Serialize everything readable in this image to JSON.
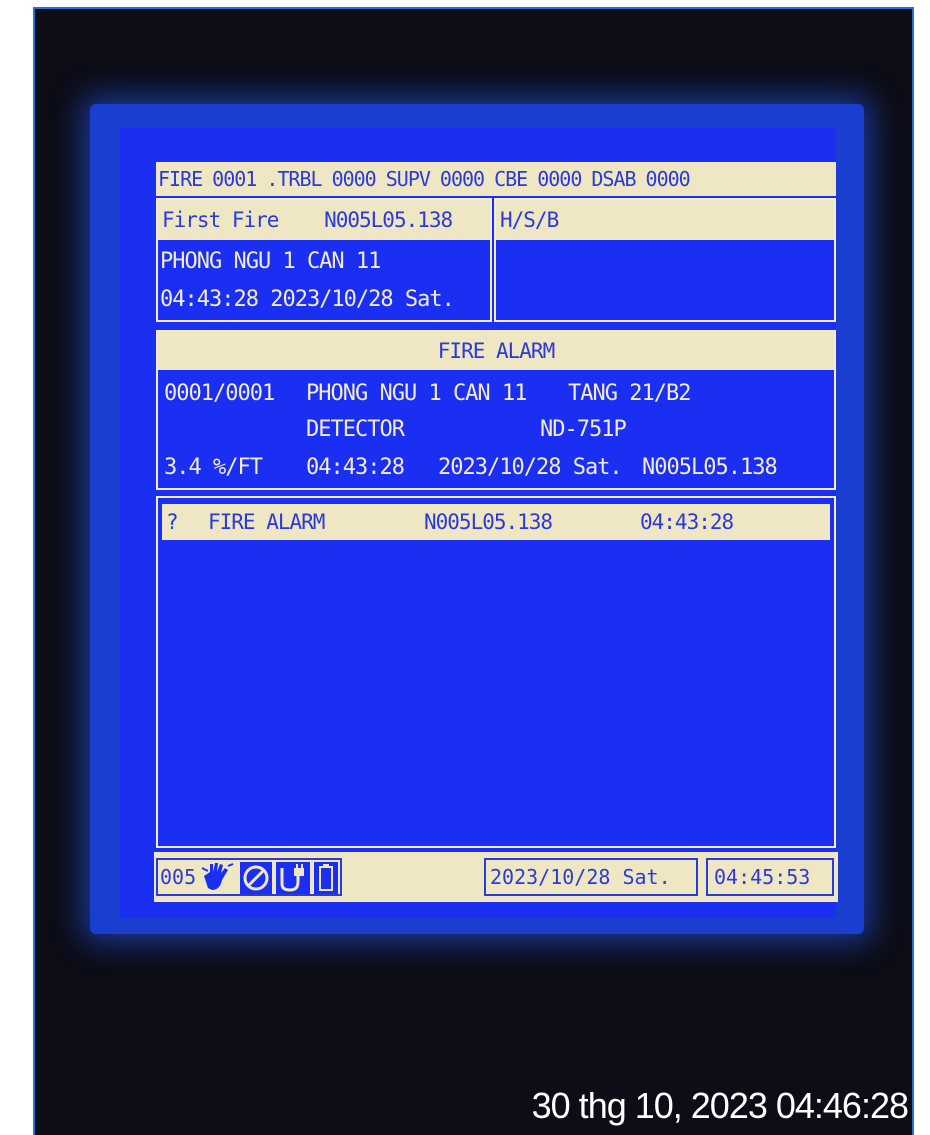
{
  "status_bar": {
    "fire_label": "FIRE",
    "fire_count": "0001",
    "trbl_label": ".TRBL",
    "trbl_count": "0000",
    "supv_label": "SUPV",
    "supv_count": "0000",
    "cbe_label": "CBE",
    "cbe_count": "0000",
    "dsab_label": "DSAB",
    "dsab_count": "0000"
  },
  "first_fire": {
    "title": "First Fire",
    "address": "N005L05.138",
    "location": "PHONG NGU 1 CAN 11",
    "datetime": "04:43:28 2023/10/28 Sat."
  },
  "hsb": {
    "title": "H/S/B"
  },
  "alarm_detail": {
    "header": "FIRE ALARM",
    "index": "0001/0001",
    "location": "PHONG NGU 1 CAN 11",
    "floor": "TANG 21/B2",
    "device_type": "DETECTOR",
    "model": "ND-751P",
    "reading": "3.4 %/FT",
    "time": "04:43:28",
    "date": "2023/10/28 Sat.",
    "address": "N005L05.138"
  },
  "event_list": {
    "items": [
      {
        "marker": "?",
        "event": "FIRE ALARM",
        "address": "N005L05.138",
        "time": "04:43:28"
      }
    ]
  },
  "footer": {
    "panel_no": "005",
    "icons": [
      "hand-icon",
      "no-sound-icon",
      "power-plug-icon",
      "battery-icon"
    ],
    "date": "2023/10/28 Sat.",
    "time": "04:45:53"
  },
  "photo_timestamp": "30 thg 10, 2023 04:46:28",
  "colors": {
    "lcd_blue": "#1a2ff2",
    "lcd_cream": "#efe7c4",
    "bezel_glow": "#1a3fd0"
  }
}
